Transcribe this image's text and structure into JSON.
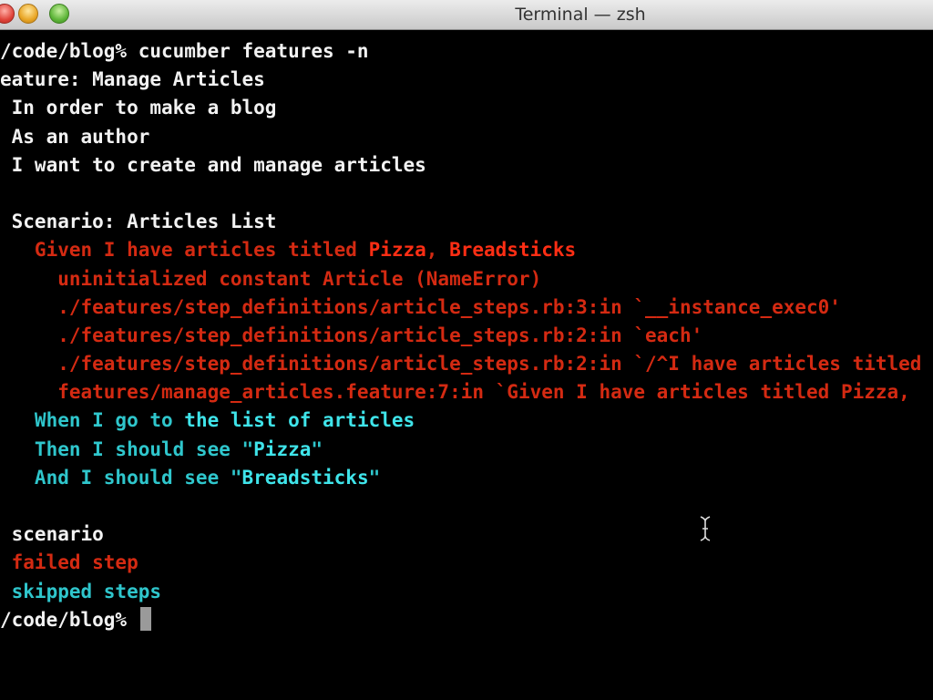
{
  "window": {
    "title": "Terminal — zsh"
  },
  "terminal": {
    "lines": [
      {
        "text": "/code/blog% cucumber features -n",
        "class": "white"
      },
      {
        "text": "eature: Manage Articles",
        "class": "white"
      },
      {
        "text": " In order to make a blog",
        "class": "white"
      },
      {
        "text": " As an author",
        "class": "white"
      },
      {
        "text": " I want to create and manage articles",
        "class": "white"
      },
      {
        "text": "",
        "class": "white"
      },
      {
        "text": " Scenario: Articles List",
        "class": "white"
      },
      {
        "segments": [
          {
            "text": "   Given I have articles titled ",
            "class": "red"
          },
          {
            "text": "Pizza",
            "class": "bright-red"
          },
          {
            "text": ", ",
            "class": "red"
          },
          {
            "text": "Breadsticks",
            "class": "bright-red"
          }
        ]
      },
      {
        "text": "     uninitialized constant Article (NameError)",
        "class": "red"
      },
      {
        "text": "     ./features/step_definitions/article_steps.rb:3:in `__instance_exec0'",
        "class": "red"
      },
      {
        "text": "     ./features/step_definitions/article_steps.rb:2:in `each'",
        "class": "red"
      },
      {
        "text": "     ./features/step_definitions/article_steps.rb:2:in `/^I have articles titled",
        "class": "red"
      },
      {
        "text": "     features/manage_articles.feature:7:in `Given I have articles titled Pizza,",
        "class": "red"
      },
      {
        "segments": [
          {
            "text": "   When I go to ",
            "class": "cyan"
          },
          {
            "text": "the list of articles",
            "class": "bright-cyan"
          }
        ]
      },
      {
        "segments": [
          {
            "text": "   Then I should see \"",
            "class": "cyan"
          },
          {
            "text": "Pizza",
            "class": "bright-cyan"
          },
          {
            "text": "\"",
            "class": "cyan"
          }
        ]
      },
      {
        "segments": [
          {
            "text": "   And I should see \"",
            "class": "cyan"
          },
          {
            "text": "Breadsticks",
            "class": "bright-cyan"
          },
          {
            "text": "\"",
            "class": "cyan"
          }
        ]
      },
      {
        "text": "",
        "class": "white"
      },
      {
        "text": " scenario",
        "class": "white"
      },
      {
        "text": " failed step",
        "class": "red"
      },
      {
        "text": " skipped steps",
        "class": "cyan"
      }
    ],
    "prompt": "/code/blog% "
  },
  "colors": {
    "background": "#000000",
    "text": "#f2f2f2",
    "error_red": "#d42a12",
    "step_cyan": "#2fc6cc"
  }
}
